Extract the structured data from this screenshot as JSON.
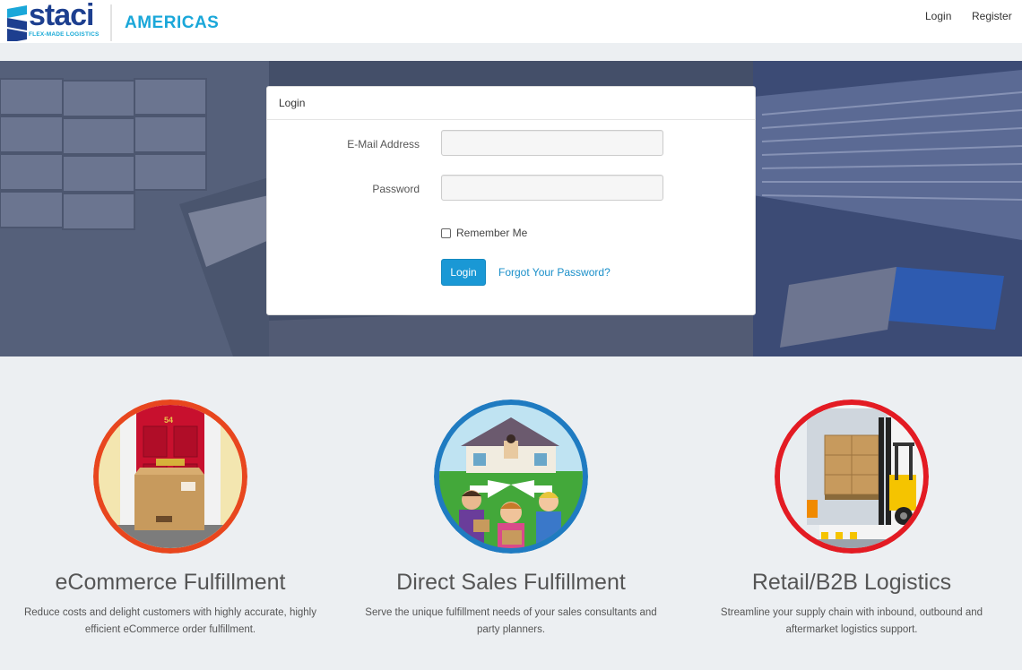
{
  "header": {
    "logo": {
      "wordmark": "staci",
      "tagline": "FLEX-MADE LOGISTICS"
    },
    "region": "AMERICAS",
    "nav": {
      "login": "Login",
      "register": "Register"
    }
  },
  "login_panel": {
    "heading": "Login",
    "email_label": "E-Mail Address",
    "email_value": "",
    "password_label": "Password",
    "password_value": "",
    "remember_label": "Remember Me",
    "remember_checked": false,
    "submit_label": "Login",
    "forgot_label": "Forgot Your Password?"
  },
  "services": [
    {
      "title": "eCommerce Fulfillment",
      "description": "Reduce costs and delight customers with highly accurate, highly efficient eCommerce order fulfillment.",
      "ring_color": "#e8461e",
      "door_number": "54"
    },
    {
      "title": "Direct Sales Fulfillment",
      "description": "Serve the unique fulfillment needs of your sales consultants and party planners.",
      "ring_color": "#1f7bc1"
    },
    {
      "title": "Retail/B2B Logistics",
      "description": "Streamline your supply chain with inbound, outbound and aftermarket logistics support.",
      "ring_color": "#e31b23"
    }
  ],
  "colors": {
    "brand_navy": "#1d3f8f",
    "brand_cyan": "#1aa7d9",
    "primary_button": "#1a98d5"
  }
}
